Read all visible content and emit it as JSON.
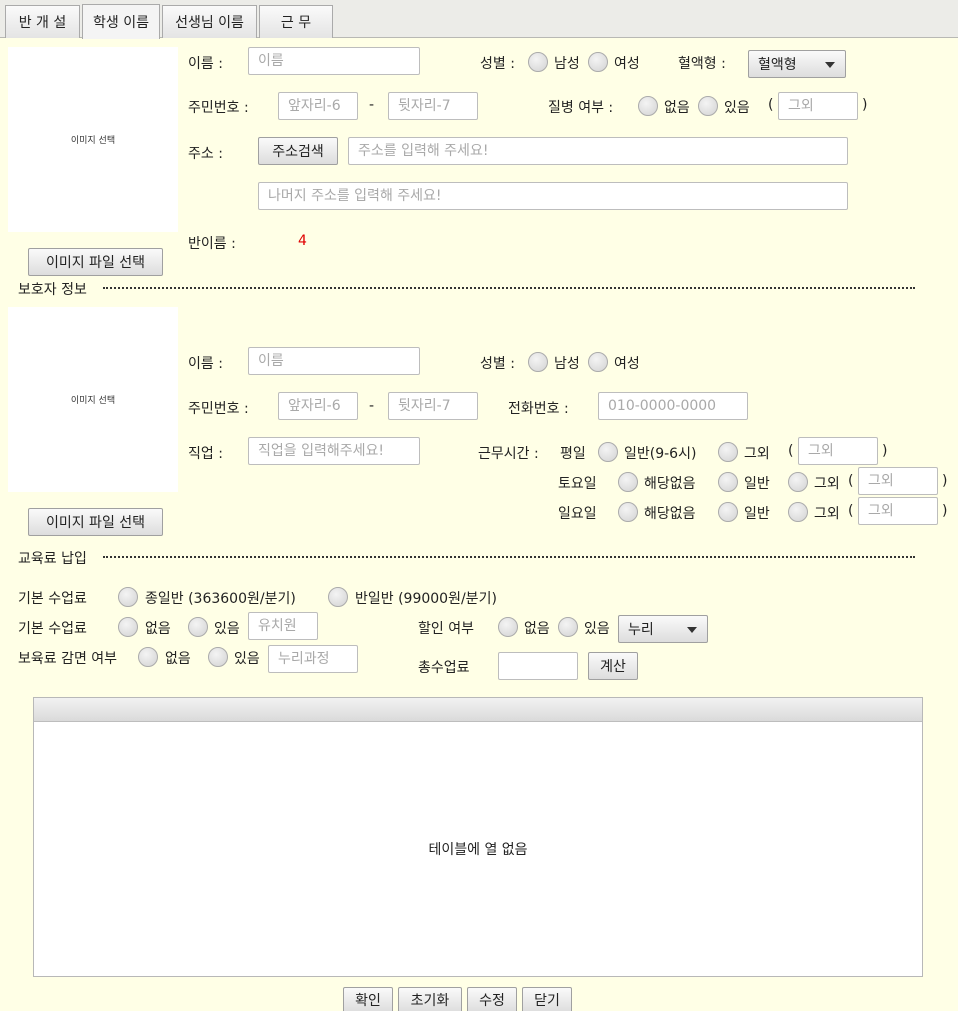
{
  "tabs": [
    "반 개 설",
    "학생 이름",
    "선생님 이름",
    "근 무"
  ],
  "student": {
    "image_placeholder": "이미지 선택",
    "image_button": "이미지 파일 선택",
    "name_label": "이름 :",
    "name_placeholder": "이름",
    "gender_label": "성별 :",
    "male": "남성",
    "female": "여성",
    "blood_label": "혈액형 :",
    "blood_value": "혈액형",
    "rrn_label": "주민번호 :",
    "rrn_front_placeholder": "앞자리-6",
    "dash": "-",
    "rrn_back_placeholder": "뒷자리-7",
    "disease_label": "질병 여부 :",
    "none": "없음",
    "yes": "있음",
    "paren_open": "(",
    "paren_close": ")",
    "other_placeholder": "그외",
    "address_label": "주소 :",
    "address_search_button": "주소검색",
    "address_placeholder": "주소를 입력해 주세요!",
    "address_rest_placeholder": "나머지 주소를 입력해 주세요!",
    "class_label": "반이름 :",
    "class_value": "4"
  },
  "guardian": {
    "section_title": "보호자 정보",
    "image_placeholder": "이미지 선택",
    "image_button": "이미지 파일 선택",
    "name_label": "이름 :",
    "name_placeholder": "이름",
    "gender_label": "성별 :",
    "male": "남성",
    "female": "여성",
    "rrn_label": "주민번호 :",
    "rrn_front_placeholder": "앞자리-6",
    "dash": "-",
    "rrn_back_placeholder": "뒷자리-7",
    "phone_label": "전화번호 :",
    "phone_placeholder": "010-0000-0000",
    "job_label": "직업 :",
    "job_placeholder": "직업을 입력해주세요!",
    "worktime_label": "근무시간 :",
    "weekday": "평일",
    "normal_9_6": "일반(9-6시)",
    "other": "그외",
    "paren_open": "(",
    "paren_open2": "(",
    "paren_close": ")",
    "other_placeholder": "그외",
    "saturday": "토요일",
    "sunday": "일요일",
    "na": "해당없음",
    "normal": "일반"
  },
  "tuition": {
    "section_title": "교육료 납입",
    "basic_label": "기본 수업료",
    "fullday": "종일반 (363600원/분기)",
    "halfday": "반일반 (99000원/분기)",
    "basic_label2": "기본 수업료",
    "none": "없음",
    "yes": "있음",
    "kinder_placeholder": "유치원",
    "discount_label": "할인 여부",
    "nuri_value": "누리",
    "reduction_label": "보육료 감면 여부",
    "nuri_course_placeholder": "누리과정",
    "total_label": "총수업료",
    "calc_button": "계산"
  },
  "table": {
    "empty_text": "테이블에 열 없음"
  },
  "footer": {
    "confirm": "확인",
    "reset": "초기화",
    "edit": "수정",
    "close": "닫기"
  }
}
